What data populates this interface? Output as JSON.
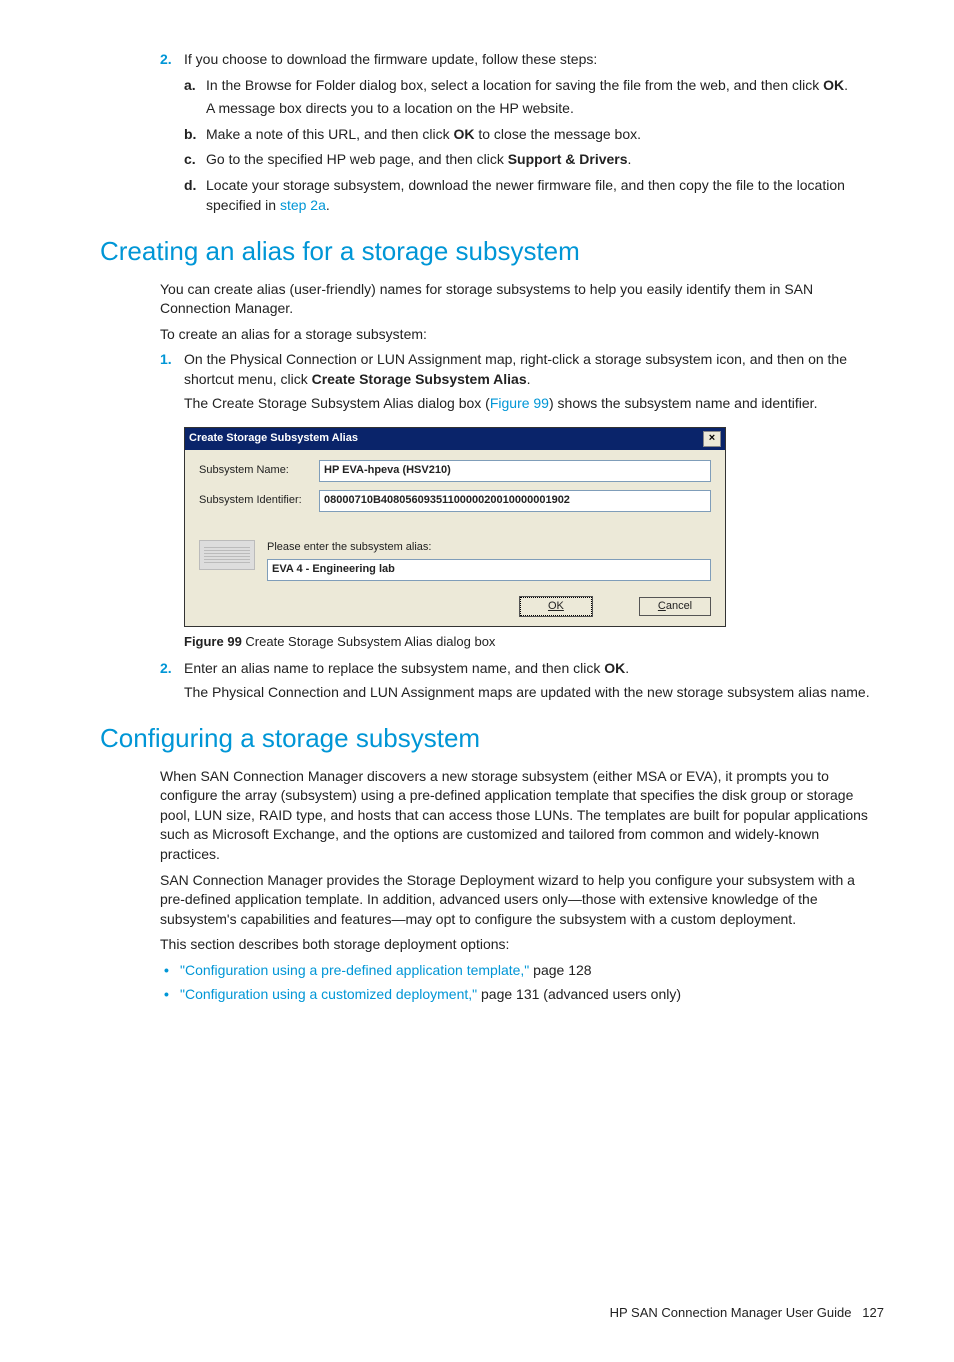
{
  "top_list": {
    "item2": {
      "marker": "2.",
      "text": "If you choose to download the firmware update, follow these steps:",
      "sub": {
        "a": {
          "marker": "a.",
          "text_before": "In the Browse for Folder dialog box, select a location for saving the file from the web, and then click ",
          "bold": "OK",
          "text_after": ".",
          "para": "A message box directs you to a location on the HP website."
        },
        "b": {
          "marker": "b.",
          "text_before": "Make a note of this URL, and then click ",
          "bold": "OK",
          "text_after": " to close the message box."
        },
        "c": {
          "marker": "c.",
          "text_before": "Go to the specified HP web page, and then click ",
          "bold": "Support & Drivers",
          "text_after": "."
        },
        "d": {
          "marker": "d.",
          "text_before": "Locate your storage subsystem, download the newer firmware file, and then copy the file to the location specified in ",
          "link": "step 2a",
          "text_after": "."
        }
      }
    }
  },
  "section1": {
    "heading": "Creating an alias for a storage subsystem",
    "p1": "You can create alias (user-friendly) names for storage subsystems to help you easily identify them in SAN Connection Manager.",
    "p2": "To create an alias for a storage subsystem:",
    "steps": {
      "s1": {
        "marker": "1.",
        "text_before": "On the Physical Connection or LUN Assignment map, right-click a storage subsystem icon, and then on the shortcut menu, click ",
        "bold": "Create Storage Subsystem Alias",
        "text_after": ".",
        "para_before": "The Create Storage Subsystem Alias dialog box (",
        "para_link": "Figure 99",
        "para_after": ") shows the subsystem name and identifier."
      },
      "s2": {
        "marker": "2.",
        "text_before": "Enter an alias name to replace the subsystem name, and then click ",
        "bold": "OK",
        "text_after": ".",
        "para": "The Physical Connection and LUN Assignment maps are updated with the new storage subsystem alias name."
      }
    },
    "figure": {
      "title": "Create Storage Subsystem Alias",
      "label_name": "Subsystem Name:",
      "val_name": "HP EVA-hpeva (HSV210)",
      "label_id": "Subsystem Identifier:",
      "val_id": "08000710B4080560935110000020010000001902",
      "alias_label": "Please enter the subsystem alias:",
      "alias_val": "EVA 4 - Engineering lab",
      "ok": "OK",
      "cancel": "Cancel",
      "caption_bold": "Figure 99",
      "caption_rest": " Create Storage Subsystem Alias dialog box"
    }
  },
  "section2": {
    "heading": "Configuring a storage subsystem",
    "p1": "When SAN Connection Manager discovers a new storage subsystem (either MSA or EVA), it prompts you to configure the array (subsystem) using a pre-defined application template that specifies the disk group or storage pool, LUN size, RAID type, and hosts that can access those LUNs. The templates are built for popular applications such as Microsoft Exchange, and the options are customized and tailored from common and widely-known practices.",
    "p2": "SAN Connection Manager provides the Storage Deployment wizard to help you configure your subsystem with a pre-defined application template. In addition, advanced users only—those with extensive knowledge of the subsystem's capabilities and features—may opt to configure the subsystem with a custom deployment.",
    "p3": "This section describes both storage deployment options:",
    "bullets": {
      "b1_link": "\"Configuration using a pre-defined application template,\"",
      "b1_rest": " page 128",
      "b2_link": "\"Configuration using a customized deployment,\"",
      "b2_rest": " page 131 (advanced users only)"
    }
  },
  "footer": {
    "text": "HP SAN Connection Manager User Guide",
    "page": "127"
  }
}
